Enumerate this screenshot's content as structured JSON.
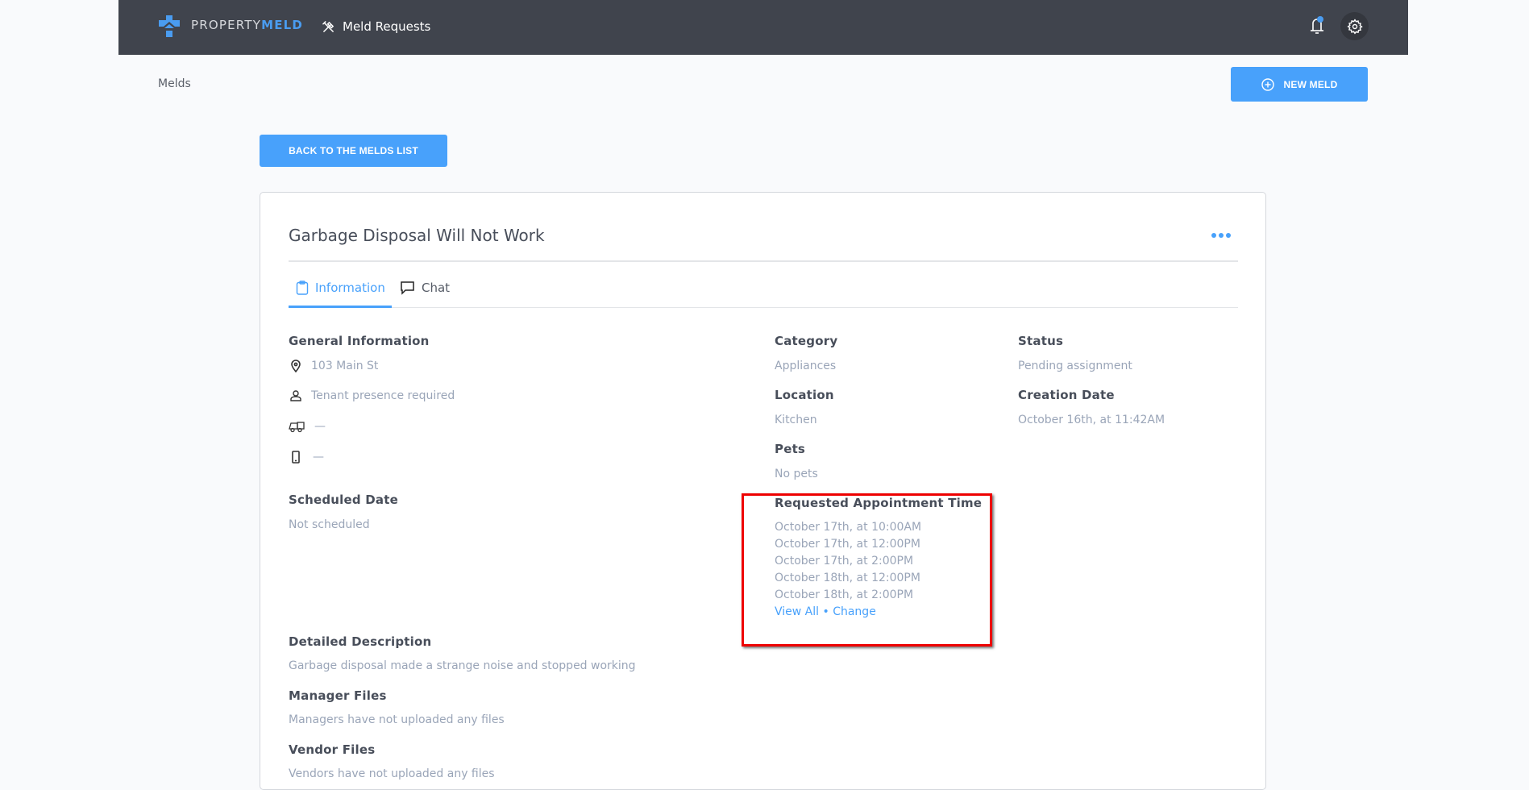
{
  "header": {
    "logo_text_a": "PROPERTY",
    "logo_text_b": "MELD",
    "nav_label": "Meld Requests",
    "nav_icon": "tools-icon",
    "notification_icon": "bell-icon",
    "settings_icon": "gear-icon"
  },
  "breadcrumb": "Melds",
  "buttons": {
    "new_meld": "NEW MELD",
    "back": "BACK TO THE MELDS LIST"
  },
  "meld": {
    "title": "Garbage Disposal Will Not Work",
    "tabs": [
      {
        "label": "Information",
        "icon": "clipboard-icon",
        "active": true
      },
      {
        "label": "Chat",
        "icon": "chat-bubble-icon",
        "active": false
      }
    ],
    "general": {
      "heading": "General Information",
      "address": "103 Main St",
      "presence": "Tenant presence required",
      "vendor": "—",
      "phone": "—"
    },
    "category": {
      "heading": "Category",
      "value": "Appliances"
    },
    "location": {
      "heading": "Location",
      "value": "Kitchen"
    },
    "pets": {
      "heading": "Pets",
      "value": "No pets"
    },
    "status": {
      "heading": "Status",
      "value": "Pending assignment"
    },
    "creation": {
      "heading": "Creation Date",
      "value": "October 16th, at 11:42AM"
    },
    "scheduled": {
      "heading": "Scheduled Date",
      "value": "Not scheduled"
    },
    "appointments": {
      "heading": "Requested Appointment Time",
      "times": [
        "October 17th, at 10:00AM",
        "October 17th, at 12:00PM",
        "October 17th, at 2:00PM",
        "October 18th, at 12:00PM",
        "October 18th, at 2:00PM"
      ],
      "view_all": "View All",
      "separator": "•",
      "change": "Change"
    },
    "description": {
      "heading": "Detailed Description",
      "value": "Garbage disposal made a strange noise and stopped working"
    },
    "manager_files": {
      "heading": "Manager Files",
      "value": "Managers have not uploaded any files"
    },
    "vendor_files": {
      "heading": "Vendor Files",
      "value": "Vendors have not uploaded any files"
    }
  },
  "colors": {
    "header_bg": "#40444d",
    "accent": "#48a1fb",
    "highlight_box": "#ee0000"
  }
}
